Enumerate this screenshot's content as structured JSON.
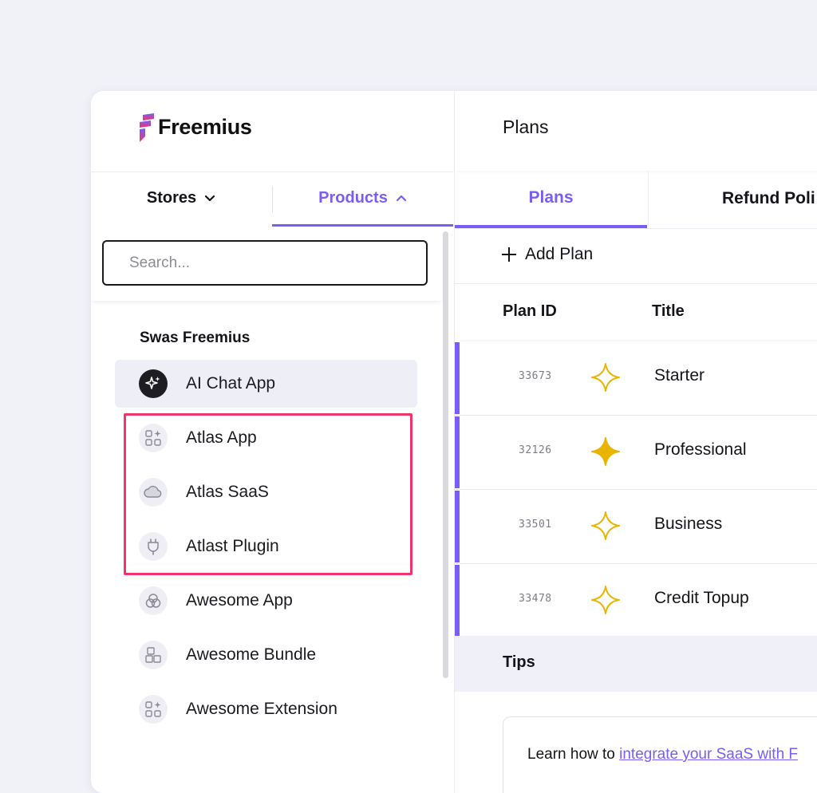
{
  "brand": {
    "name": "Freemius"
  },
  "sidebar": {
    "tabs": [
      {
        "label": "Stores",
        "icon": "chevron-down-icon",
        "active": false
      },
      {
        "label": "Products",
        "icon": "chevron-up-icon",
        "active": true
      }
    ],
    "search": {
      "placeholder": "Search...",
      "value": ""
    },
    "group_title": "Swas Freemius",
    "products": [
      {
        "label": "AI Chat App",
        "icon": "sparkle-icon",
        "active": true
      },
      {
        "label": "Atlas App",
        "icon": "app-grid-icon"
      },
      {
        "label": "Atlas SaaS",
        "icon": "cloud-icon"
      },
      {
        "label": "Atlast Plugin",
        "icon": "plug-icon"
      },
      {
        "label": "Awesome App",
        "icon": "app-swirl-icon"
      },
      {
        "label": "Awesome Bundle",
        "icon": "bundle-icon"
      },
      {
        "label": "Awesome Extension",
        "icon": "app-grid-icon"
      }
    ]
  },
  "main": {
    "title": "Plans",
    "tabs": [
      {
        "label": "Plans",
        "active": true
      },
      {
        "label": "Refund Poli"
      }
    ],
    "add_plan_label": "Add Plan",
    "table": {
      "headers": [
        "Plan ID",
        "Title"
      ],
      "rows": [
        {
          "id": "33673",
          "title": "Starter",
          "star": "star-outline-icon"
        },
        {
          "id": "32126",
          "title": "Professional",
          "star": "star-filled-icon"
        },
        {
          "id": "33501",
          "title": "Business",
          "star": "star-outline-icon"
        },
        {
          "id": "33478",
          "title": "Credit Topup",
          "star": "star-outline-icon"
        }
      ]
    },
    "tips": {
      "title": "Tips",
      "text_prefix": "Learn how to ",
      "link_text": "integrate your SaaS with F"
    }
  },
  "colors": {
    "accent": "#7b5cf5",
    "highlight": "#f0346c",
    "star": "#e8b400",
    "background": "#f1f1f8"
  }
}
